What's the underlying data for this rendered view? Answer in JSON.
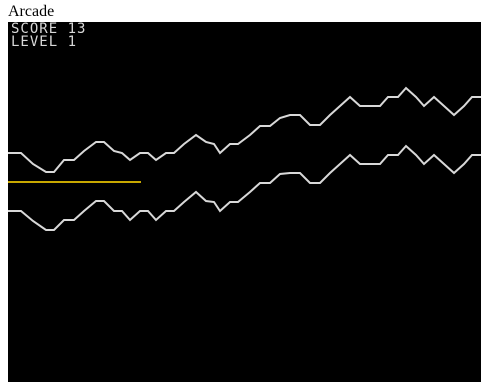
{
  "window": {
    "title": "Arcade"
  },
  "hud": {
    "score_label": "SCORE",
    "score_value": "13",
    "level_label": "LEVEL",
    "level_value": "1"
  },
  "colors": {
    "background": "#000000",
    "wall": "#d8d8d8",
    "player_trail": "#c8a800",
    "hud_text": "#d8d8d8"
  }
}
